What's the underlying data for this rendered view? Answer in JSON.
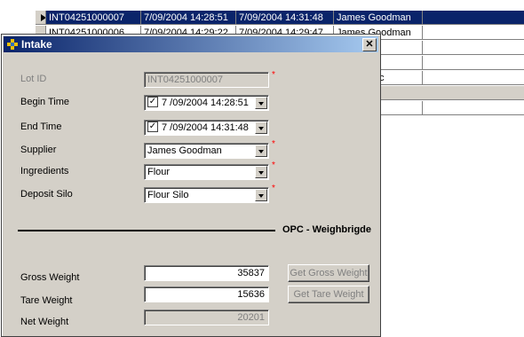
{
  "grid": {
    "rows": [
      {
        "lot_id": "INT04251000007",
        "begin": "7/09/2004 14:28:51",
        "end": "7/09/2004 14:31:48",
        "supplier": "James Goodman",
        "selected": true
      },
      {
        "lot_id": "INT04251000006",
        "begin": "7/09/2004 14:29:22",
        "end": "7/09/2004 14:29:47",
        "supplier": "James Goodman",
        "selected": false
      },
      {
        "lot_id": "",
        "begin": "",
        "end": "",
        "supplier": "odman",
        "selected": false
      },
      {
        "lot_id": "",
        "begin": "",
        "end": "",
        "supplier": "odman",
        "selected": false
      },
      {
        "lot_id": "",
        "begin": "",
        "end": "",
        "supplier": "ribution Cc",
        "selected": false
      }
    ]
  },
  "dialog": {
    "title": "Intake",
    "close_glyph": "✕",
    "lot_id_label": "Lot ID",
    "lot_id_value": "INT04251000007",
    "begin_label": "Begin Time",
    "begin_value": "7 /09/2004 14:28:51",
    "end_label": "End Time",
    "end_value": "7 /09/2004 14:31:48",
    "supplier_label": "Supplier",
    "supplier_value": "James Goodman",
    "ingredients_label": "Ingredients",
    "ingredients_value": "Flour",
    "silo_label": "Deposit Silo",
    "silo_value": "Flour Silo",
    "required_mark": "*",
    "check_mark": "✓",
    "section_title": "OPC - Weighbrigde",
    "gross_label": "Gross Weight",
    "gross_value": "35837",
    "get_gross_label": "Get Gross Weight",
    "tare_label": "Tare Weight",
    "tare_value": "15636",
    "get_tare_label": "Get Tare Weight",
    "net_label": "Net Weight",
    "net_value": "20201"
  }
}
